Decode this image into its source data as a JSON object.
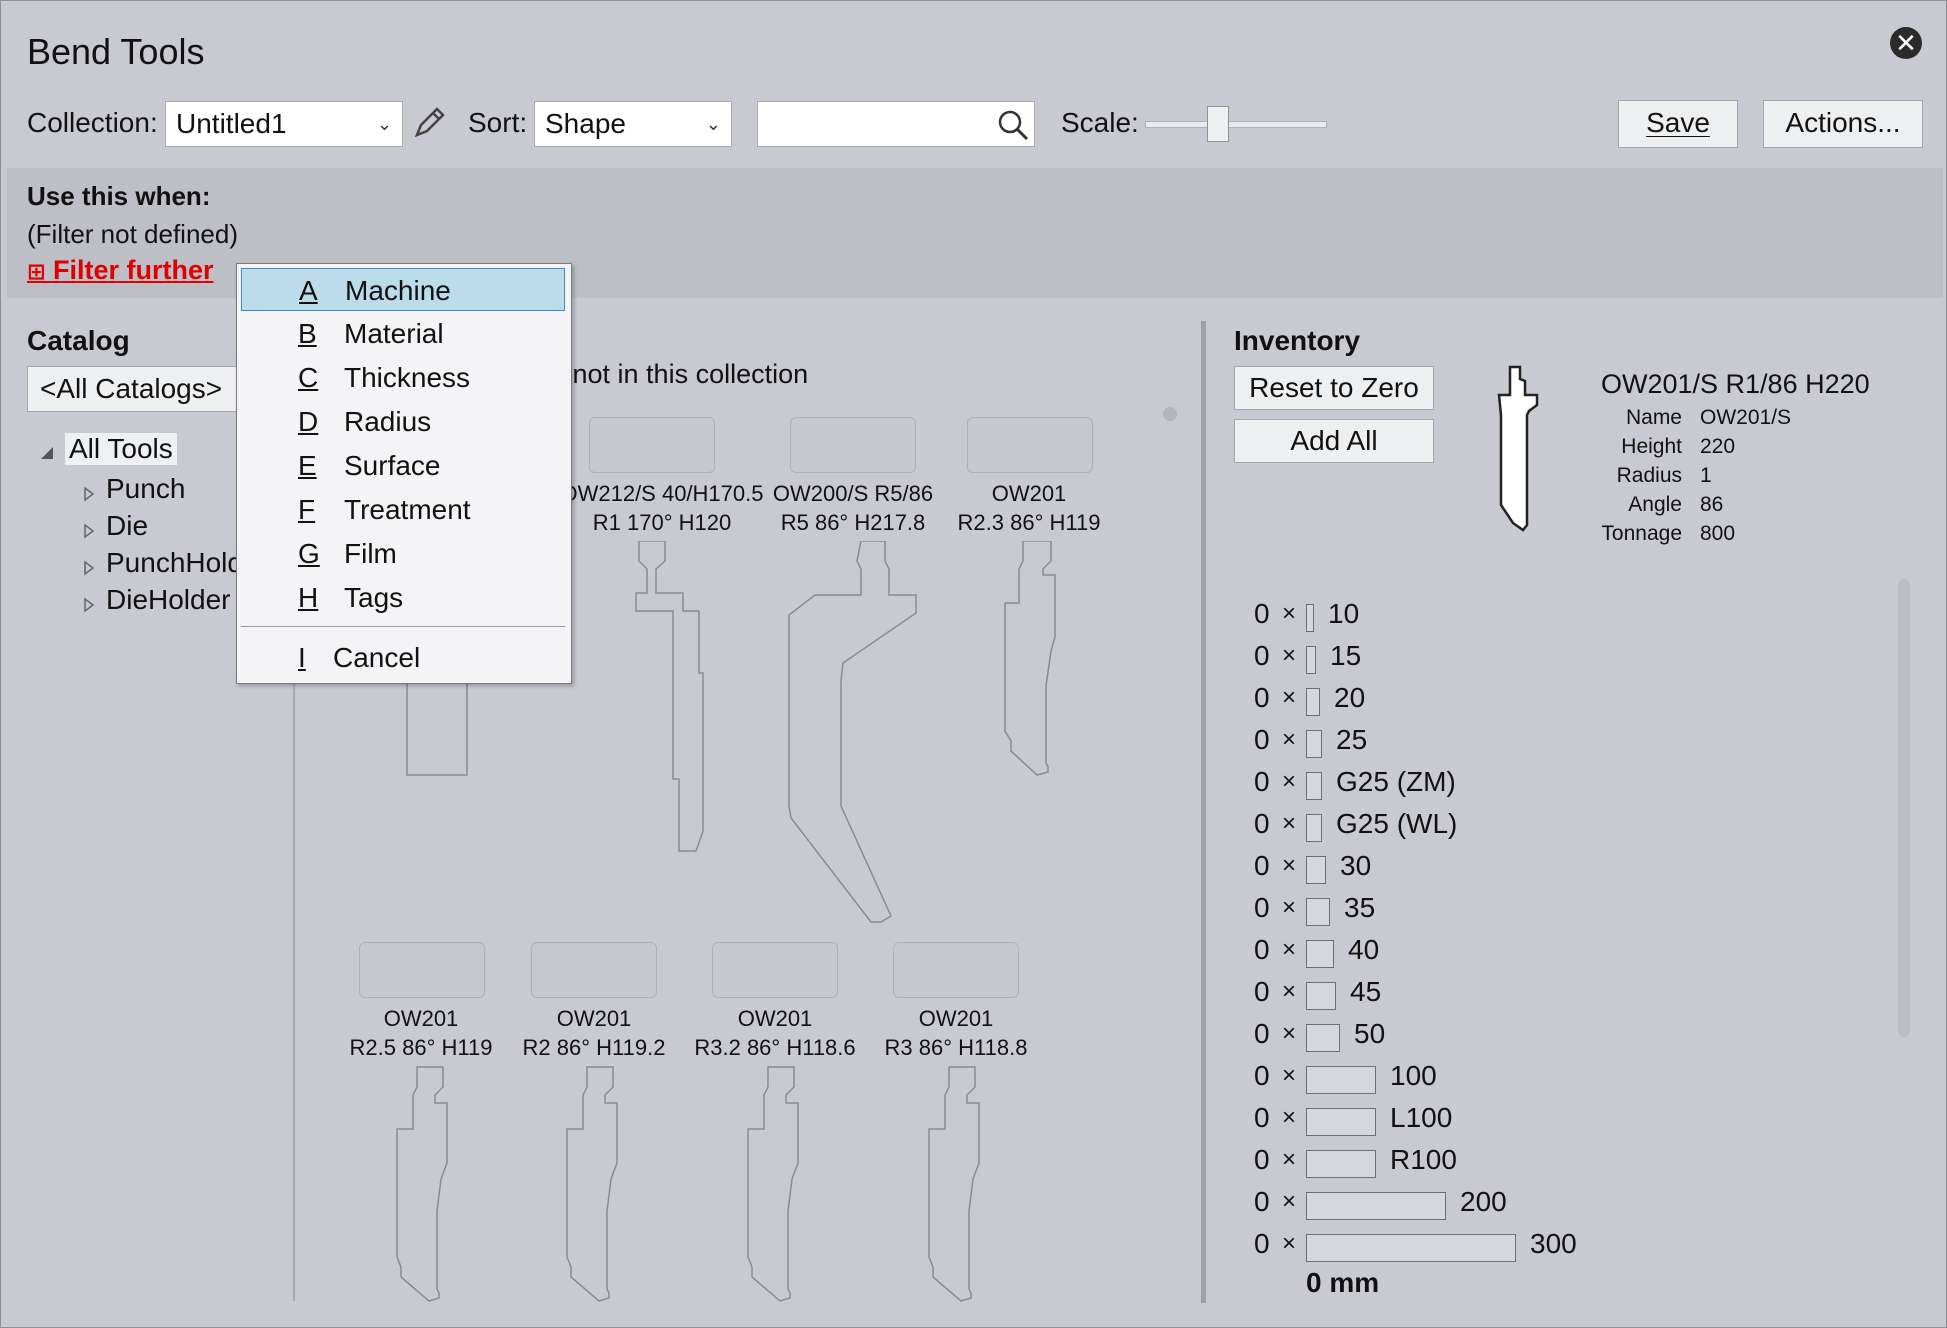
{
  "window": {
    "title": "Bend Tools"
  },
  "toolbar": {
    "collection_label": "Collection:",
    "collection_value": "Untitled1",
    "sort_label": "Sort:",
    "sort_value": "Shape",
    "search_value": "",
    "scale_label": "Scale:",
    "scale_level": 0.4,
    "save_label": "Save",
    "actions_label": "Actions..."
  },
  "filter": {
    "heading": "Use this when:",
    "status": "(Filter not defined)",
    "filter_further": "Filter further"
  },
  "menu": {
    "items": [
      {
        "key": "A",
        "label": "Machine",
        "selected": true
      },
      {
        "key": "B",
        "label": "Material"
      },
      {
        "key": "C",
        "label": "Thickness"
      },
      {
        "key": "D",
        "label": "Radius"
      },
      {
        "key": "E",
        "label": "Surface"
      },
      {
        "key": "F",
        "label": "Treatment"
      },
      {
        "key": "G",
        "label": "Film"
      },
      {
        "key": "H",
        "label": "Tags"
      }
    ],
    "cancel": {
      "key": "I",
      "label": "Cancel"
    }
  },
  "catalog": {
    "heading": "Catalog",
    "selector": "<All Catalogs>",
    "tree": {
      "root": "All Tools",
      "children": [
        "Punch",
        "Die",
        "PunchHolder",
        "DieHolder"
      ]
    }
  },
  "gallery": {
    "notice": "...not in this collection",
    "tools": [
      {
        "line1": "OW212/S 40/H170.5",
        "line2": "R1  170°  H120"
      },
      {
        "line1": "OW200/S R5/86",
        "line2": "R5  86°  H217.8"
      },
      {
        "line1": "OW201",
        "line2": "R2.3  86°  H119"
      },
      {
        "line1": "OW201",
        "line2": "R2.5  86°  H119"
      },
      {
        "line1": "OW201",
        "line2": "R2  86°  H119.2"
      },
      {
        "line1": "OW201",
        "line2": "R3.2  86°  H118.6"
      },
      {
        "line1": "OW201",
        "line2": "R3  86°  H118.8"
      }
    ]
  },
  "inventory": {
    "heading": "Inventory",
    "reset_label": "Reset to Zero",
    "add_all_label": "Add All",
    "tool_title": "OW201/S R1/86 H220",
    "props": [
      {
        "k": "Name",
        "v": "OW201/S"
      },
      {
        "k": "Height",
        "v": "220"
      },
      {
        "k": "Radius",
        "v": "1"
      },
      {
        "k": "Angle",
        "v": "86"
      },
      {
        "k": "Tonnage",
        "v": "800"
      }
    ],
    "segments": [
      {
        "qty": "0",
        "x": "×",
        "name": "10"
      },
      {
        "qty": "0",
        "x": "×",
        "name": "15"
      },
      {
        "qty": "0",
        "x": "×",
        "name": "20"
      },
      {
        "qty": "0",
        "x": "×",
        "name": "25"
      },
      {
        "qty": "0",
        "x": "×",
        "name": "G25 (ZM)"
      },
      {
        "qty": "0",
        "x": "×",
        "name": "G25 (WL)"
      },
      {
        "qty": "0",
        "x": "×",
        "name": "30"
      },
      {
        "qty": "0",
        "x": "×",
        "name": "35"
      },
      {
        "qty": "0",
        "x": "×",
        "name": "40"
      },
      {
        "qty": "0",
        "x": "×",
        "name": "45"
      },
      {
        "qty": "0",
        "x": "×",
        "name": "50"
      },
      {
        "qty": "0",
        "x": "×",
        "name": "100"
      },
      {
        "qty": "0",
        "x": "×",
        "name": "L100"
      },
      {
        "qty": "0",
        "x": "×",
        "name": "R100"
      },
      {
        "qty": "0",
        "x": "×",
        "name": "200"
      },
      {
        "qty": "0",
        "x": "×",
        "name": "300"
      }
    ],
    "total": "0 mm"
  }
}
